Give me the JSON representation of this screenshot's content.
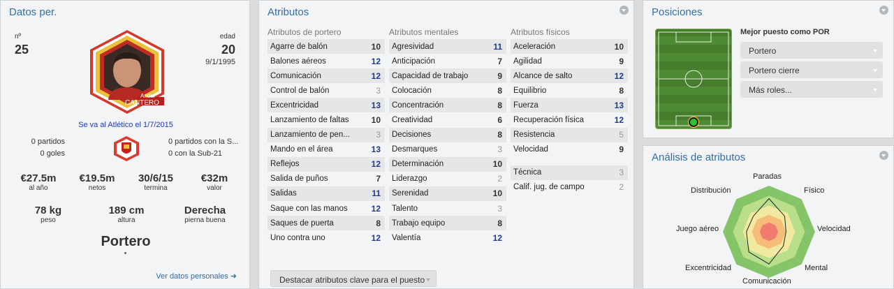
{
  "personal": {
    "title": "Datos per.",
    "num_label": "nº",
    "num": "25",
    "age_label": "edad",
    "age": "20",
    "dob": "9/1/1995",
    "first_name": "Ander",
    "last_name": "CANTERO",
    "transfer_note": "Se va al Atlético el 1/7/2015",
    "caps_left": [
      "0 partidos",
      "0 goles"
    ],
    "caps_right": [
      "0 partidos con la S...",
      "0 con la Sub-21"
    ],
    "money": [
      {
        "value": "€27.5m",
        "label": "al año"
      },
      {
        "value": "€19.5m",
        "label": "netos"
      },
      {
        "value": "30/6/15",
        "label": "termina"
      },
      {
        "value": "€32m",
        "label": "valor"
      }
    ],
    "physical": [
      {
        "value": "78 kg",
        "label": "peso"
      },
      {
        "value": "189 cm",
        "label": "altura"
      },
      {
        "value": "Derecha",
        "label": "pierna buena"
      }
    ],
    "position": "Portero",
    "more_link": "Ver datos personales ➜"
  },
  "attributes": {
    "title": "Atributos",
    "columns": [
      {
        "header": "Atributos de portero",
        "rows": [
          {
            "name": "Agarre de balón",
            "value": "10"
          },
          {
            "name": "Balones aéreos",
            "value": "12"
          },
          {
            "name": "Comunicación",
            "value": "12"
          },
          {
            "name": "Control de balón",
            "value": "3"
          },
          {
            "name": "Excentricidad",
            "value": "13"
          },
          {
            "name": "Lanzamiento de faltas",
            "value": "10"
          },
          {
            "name": "Lanzamiento de pen...",
            "value": "3"
          },
          {
            "name": "Mando en el área",
            "value": "13"
          },
          {
            "name": "Reflejos",
            "value": "12"
          },
          {
            "name": "Salida de puños",
            "value": "7"
          },
          {
            "name": "Salidas",
            "value": "11"
          },
          {
            "name": "Saque con las manos",
            "value": "12"
          },
          {
            "name": "Saques de puerta",
            "value": "8"
          },
          {
            "name": "Uno contra uno",
            "value": "12"
          }
        ]
      },
      {
        "header": "Atributos mentales",
        "rows": [
          {
            "name": "Agresividad",
            "value": "11"
          },
          {
            "name": "Anticipación",
            "value": "7"
          },
          {
            "name": "Capacidad de trabajo",
            "value": "9"
          },
          {
            "name": "Colocación",
            "value": "8"
          },
          {
            "name": "Concentración",
            "value": "8"
          },
          {
            "name": "Creatividad",
            "value": "6"
          },
          {
            "name": "Decisiones",
            "value": "8"
          },
          {
            "name": "Desmarques",
            "value": "3"
          },
          {
            "name": "Determinación",
            "value": "10"
          },
          {
            "name": "Liderazgo",
            "value": "2"
          },
          {
            "name": "Serenidad",
            "value": "10"
          },
          {
            "name": "Talento",
            "value": "3"
          },
          {
            "name": "Trabajo equipo",
            "value": "8"
          },
          {
            "name": "Valentía",
            "value": "12"
          }
        ]
      },
      {
        "header": "Atributos físicos",
        "rows": [
          {
            "name": "Aceleración",
            "value": "10"
          },
          {
            "name": "Agilidad",
            "value": "9"
          },
          {
            "name": "Alcance de salto",
            "value": "12"
          },
          {
            "name": "Equilibrio",
            "value": "8"
          },
          {
            "name": "Fuerza",
            "value": "13"
          },
          {
            "name": "Recuperación física",
            "value": "12"
          },
          {
            "name": "Resistencia",
            "value": "5"
          },
          {
            "name": "Velocidad",
            "value": "9"
          }
        ]
      }
    ],
    "extra": [
      {
        "name": "Técnica",
        "value": "3"
      },
      {
        "name": "Calif. jug. de campo",
        "value": "2"
      }
    ],
    "highlight_btn": "Destacar atributos clave para el puesto"
  },
  "positions": {
    "title": "Posiciones",
    "best_label": "Mejor puesto como POR",
    "dropdowns": [
      "Portero",
      "Portero cierre",
      "Más roles..."
    ]
  },
  "analysis": {
    "title": "Análisis de atributos",
    "labels": [
      "Paradas",
      "Físico",
      "Velocidad",
      "Mental",
      "Comunicación",
      "Excentricidad",
      "Juego aéreo",
      "Distribución"
    ],
    "values": [
      0.72,
      0.48,
      0.37,
      0.44,
      0.7,
      0.62,
      0.49,
      0.48
    ]
  }
}
